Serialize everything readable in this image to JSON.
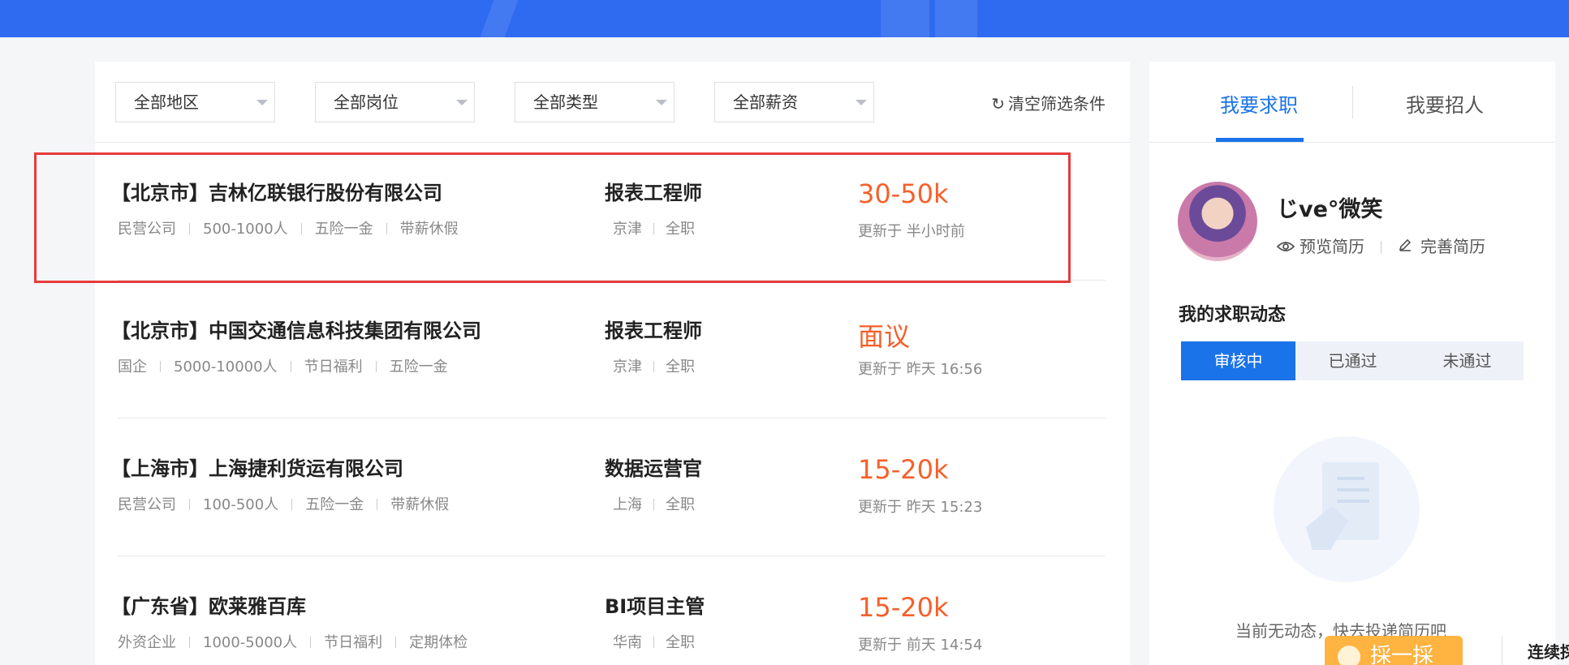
{
  "filters": {
    "region": "全部地区",
    "position": "全部岗位",
    "type": "全部类型",
    "salary": "全部薪资",
    "clear_label": "清空筛选条件",
    "clear_icon": "refresh-icon"
  },
  "jobs": [
    {
      "company": "【北京市】吉林亿联银行股份有限公司",
      "tags": [
        "民营公司",
        "500-1000人",
        "五险一金",
        "带薪休假"
      ],
      "title": "报表工程师",
      "location": "京津",
      "work_type": "全职",
      "salary": "30-50k",
      "updated": "更新于 半小时前"
    },
    {
      "company": "【北京市】中国交通信息科技集团有限公司",
      "tags": [
        "国企",
        "5000-10000人",
        "节日福利",
        "五险一金"
      ],
      "title": "报表工程师",
      "location": "京津",
      "work_type": "全职",
      "salary": "面议",
      "updated": "更新于 昨天 16:56"
    },
    {
      "company": "【上海市】上海捷利货运有限公司",
      "tags": [
        "民营公司",
        "100-500人",
        "五险一金",
        "带薪休假"
      ],
      "title": "数据运营官",
      "location": "上海",
      "work_type": "全职",
      "salary": "15-20k",
      "updated": "更新于 昨天 15:23"
    },
    {
      "company": "【广东省】欧莱雅百库",
      "tags": [
        "外资企业",
        "1000-5000人",
        "节日福利",
        "定期体检"
      ],
      "title": "BI项目主管",
      "location": "华南",
      "work_type": "全职",
      "salary": "15-20k",
      "updated": "更新于 前天 14:54"
    }
  ],
  "side": {
    "tab_seek": "我要求职",
    "tab_hire": "我要招人",
    "user_name": "じve°微笑",
    "preview_resume": "预览简历",
    "edit_resume": "完善简历",
    "status_title": "我的求职动态",
    "status_tabs": [
      "审核中",
      "已通过",
      "未通过"
    ],
    "empty_text": "当前无动态，快去投递简历吧"
  },
  "promo": {
    "button_label": "採一採",
    "side_text": "连续採"
  },
  "colors": {
    "accent": "#1a73e8",
    "salary": "#f5602a",
    "highlight": "#e73b3b",
    "banner": "#2f6bf0"
  }
}
